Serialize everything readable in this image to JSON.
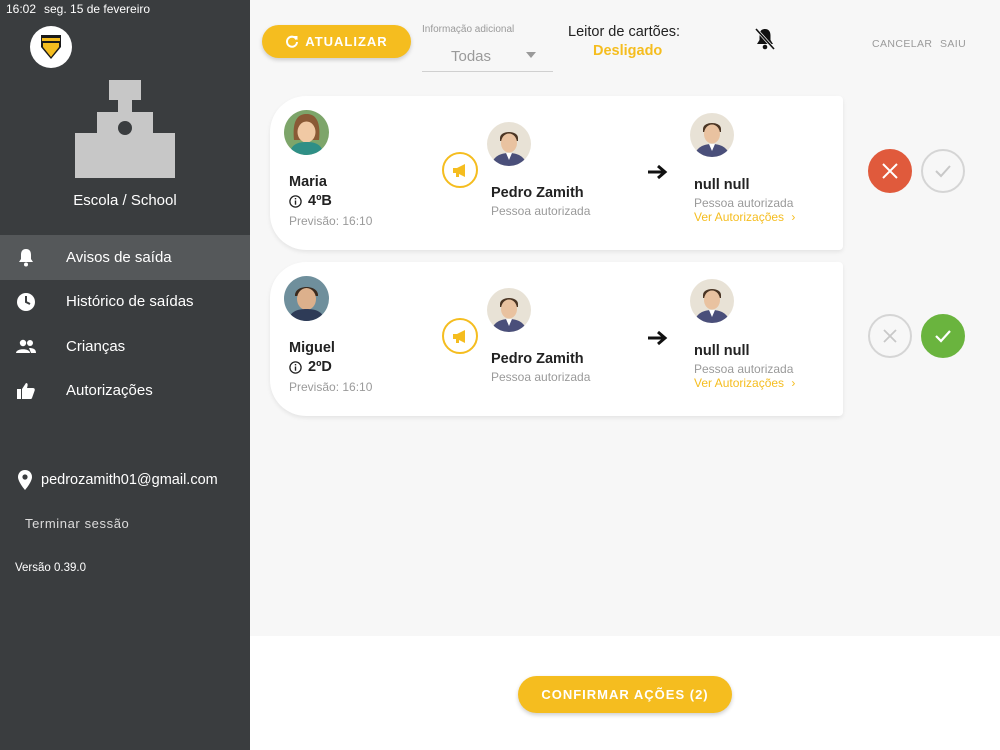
{
  "status_bar": {
    "time": "16:02",
    "date": "seg. 15 de fevereiro"
  },
  "sidebar": {
    "school_name": "Escola / School",
    "nav": [
      {
        "label": "Avisos de saída",
        "icon": "bell-icon",
        "active": true
      },
      {
        "label": "Histórico de saídas",
        "icon": "clock-icon",
        "active": false
      },
      {
        "label": "Crianças",
        "icon": "people-icon",
        "active": false
      },
      {
        "label": "Autorizações",
        "icon": "thumbs-up-icon",
        "active": false
      }
    ],
    "email": "pedrozamith01@gmail.com",
    "logout": "Terminar sessão",
    "version": "Versão 0.39.0"
  },
  "header": {
    "refresh_label": "ATUALIZAR",
    "info_label": "Informação adicional",
    "info_value": "Todas",
    "reader_title": "Leitor de cartões:",
    "reader_status": "Desligado",
    "cancel_label": "CANCELAR",
    "exit_label": "SAIU"
  },
  "cards": [
    {
      "child_name": "Maria",
      "child_class": "4ºB",
      "eta": "Previsão: 16:10",
      "from_name": "Pedro Zamith",
      "from_role": "Pessoa autorizada",
      "to_name": "null null",
      "to_role": "Pessoa autorizada",
      "view_auth": "Ver Autorizações",
      "selected_action": "reject"
    },
    {
      "child_name": "Miguel",
      "child_class": "2ºD",
      "eta": "Previsão: 16:10",
      "from_name": "Pedro Zamith",
      "from_role": "Pessoa autorizada",
      "to_name": "null null",
      "to_role": "Pessoa autorizada",
      "view_auth": "Ver Autorizações",
      "selected_action": "accept"
    }
  ],
  "footer": {
    "confirm_label": "CONFIRMAR AÇÕES (2)"
  },
  "colors": {
    "accent": "#f5bd1f",
    "sidebar_bg": "#3a3d3f",
    "reject": "#e05a3c",
    "accept": "#6ab43e"
  }
}
